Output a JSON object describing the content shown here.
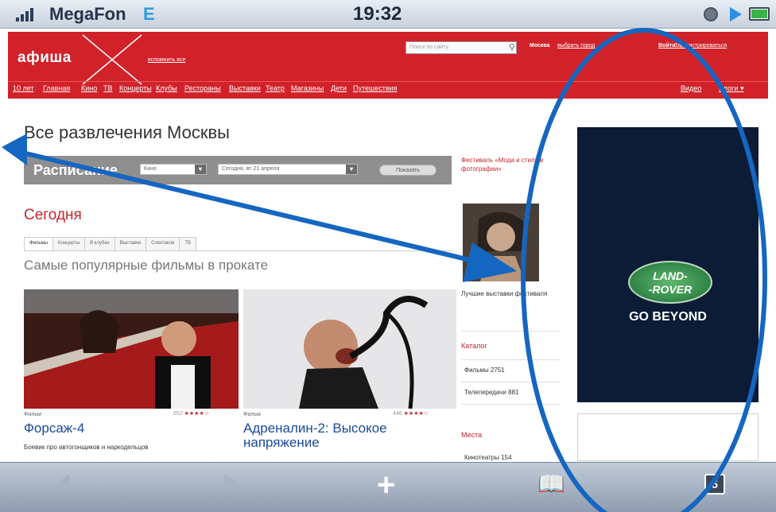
{
  "status_bar": {
    "carrier": "MegaFon",
    "network": "E",
    "time": "19:32"
  },
  "header": {
    "logo": "афиша",
    "remember": "вспомнить все",
    "search_placeholder": "Поиск по сайту",
    "city": "Москва",
    "choose_city": "выбрать город",
    "login": "Войти",
    "register": "Зарегистрироваться",
    "nav": [
      "10 лет",
      "Главная",
      "Кино",
      "ТВ",
      "Концерты",
      "Клубы",
      "Рестораны",
      "Выставки",
      "Театр",
      "Магазины",
      "Дети",
      "Путешествия"
    ],
    "nav_right": [
      "Видео",
      "Блоги ▾"
    ]
  },
  "page": {
    "title": "Все развлечения Москвы",
    "schedule_label": "Расписание",
    "schedule_select1": "Кино",
    "schedule_select2": "Сегодня, вт 21 апреля",
    "show_button": "Показать",
    "today": "Сегодня",
    "tabs": [
      "Фильмы",
      "Концерты",
      "В клубах",
      "Выставки",
      "Спектакли",
      "ТВ"
    ],
    "popular": "Самые популярные фильмы в прокате",
    "movies": [
      {
        "genre": "Фильм",
        "title": "Форсаж-4",
        "votes": "852",
        "stars": "★★★★☆",
        "desc": "Боевик про автогонщиков и наркодельцов"
      },
      {
        "genre": "Фильм",
        "title": "Адреналин-2: Высокое напряжение",
        "votes": "446",
        "stars": "★★★★☆"
      }
    ],
    "side": {
      "festival": "Фестиваль «Мода и стиль в фотографии»",
      "best": "Лучшие выставки фестиваля",
      "catalog": "Каталог",
      "films": "Фильмы 2751",
      "tv": "Телепередачи 881",
      "places": "Места",
      "places_count": "Кинотеатры 154"
    },
    "ad": {
      "brand1": "LAND-",
      "brand2": "-ROVER",
      "tagline": "GO BEYOND"
    }
  },
  "toolbar": {
    "tabs_count": "5"
  },
  "colors": {
    "afisha_red": "#d1222a",
    "annotation_blue": "#1566c0"
  }
}
